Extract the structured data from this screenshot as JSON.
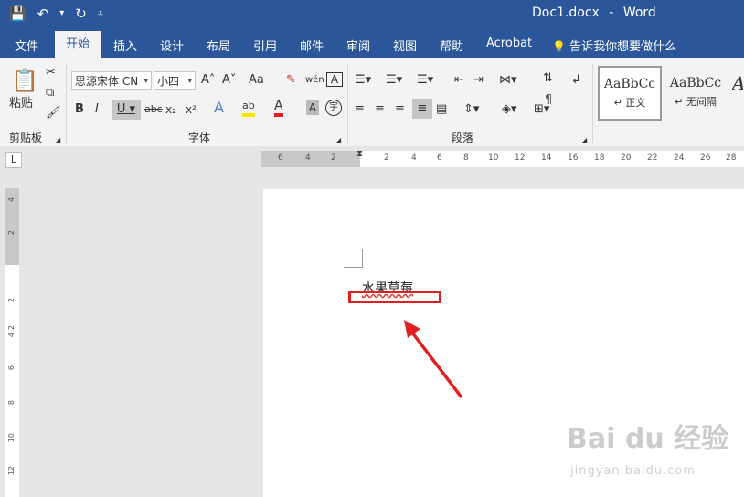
{
  "title_bar": {
    "doc_title": "Doc1.docx",
    "app_name": "Word",
    "separator": "-",
    "qat": {
      "save_icon": "💾",
      "undo_icon": "↶",
      "undo_dropdown": "▾",
      "redo_icon": "↻",
      "customize_icon": "⩡"
    }
  },
  "tabs": [
    "文件",
    "开始",
    "插入",
    "设计",
    "布局",
    "引用",
    "邮件",
    "审阅",
    "视图",
    "帮助",
    "Acrobat"
  ],
  "tell_me": {
    "icon": "💡",
    "text": "告诉我你想要做什么"
  },
  "clipboard": {
    "paste_label": "粘贴",
    "group_label": "剪贴板"
  },
  "font": {
    "font_name": "思源宋体 CN",
    "font_size": "小四",
    "group_label": "字体",
    "grow": "A˄",
    "shrink": "A˅",
    "case": "Aa",
    "clear": "✎",
    "phonetic": "wén",
    "border": "A",
    "bold": "B",
    "italic": "I",
    "underline": "U",
    "strike": "abc",
    "subscript": "x₂",
    "superscript": "x²",
    "effects": "A",
    "highlight": "ab",
    "color": "A",
    "shading": "A",
    "enclose": "字"
  },
  "paragraph": {
    "group_label": "段落"
  },
  "styles": [
    {
      "preview": "AaBbCc",
      "name": "↵ 正文"
    },
    {
      "preview": "AaBbCc",
      "name": "↵ 无间隔"
    },
    {
      "preview": "A",
      "name": ""
    }
  ],
  "ruler": {
    "tab_selector": "L",
    "h_ticks": [
      "6",
      "4",
      "2",
      "2",
      "4",
      "6",
      "8",
      "10",
      "12",
      "14",
      "16",
      "18",
      "20",
      "22",
      "24",
      "26",
      "28"
    ],
    "v_ticks": [
      "4",
      "2",
      "2",
      "2",
      "4",
      "6",
      "8",
      "10",
      "12"
    ]
  },
  "document": {
    "text": "水果草莓"
  },
  "watermark": {
    "brand": "Bai du 经验",
    "url": "jingyan.baidu.com"
  },
  "colors": {
    "word_blue": "#2b579a",
    "highlight_red": "#e02020"
  }
}
